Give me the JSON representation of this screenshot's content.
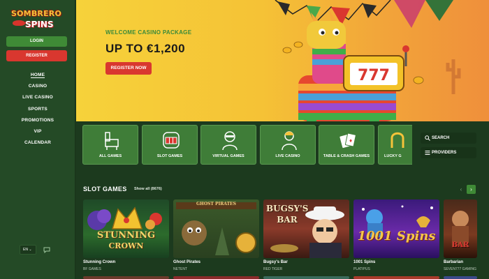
{
  "brand": {
    "line1": "SOMBRERO",
    "line2": "SPINS"
  },
  "auth": {
    "login": "LOGIN",
    "register": "REGISTER"
  },
  "nav": [
    {
      "label": "HOME",
      "active": true
    },
    {
      "label": "CASINO"
    },
    {
      "label": "LIVE CASINO"
    },
    {
      "label": "SPORTS"
    },
    {
      "label": "PROMOTIONS"
    },
    {
      "label": "VIP"
    },
    {
      "label": "CALENDAR"
    }
  ],
  "language": {
    "value": "EN"
  },
  "hero": {
    "kicker": "WELCOME CASINO PACKAGE",
    "headline": "UP TO €1,200",
    "cta": "REGISTER NOW",
    "slot_art": "777"
  },
  "categories": [
    {
      "label": "ALL GAMES",
      "icon": "llama-icon"
    },
    {
      "label": "SLOT GAMES",
      "icon": "slot-machine-icon"
    },
    {
      "label": "VIRTUAL GAMES",
      "icon": "virtual-player-icon"
    },
    {
      "label": "LIVE CASINO",
      "icon": "live-dealer-icon"
    },
    {
      "label": "TABLE & CRASH GAMES",
      "icon": "playing-cards-icon"
    },
    {
      "label": "LUCKY G",
      "icon": "horseshoe-icon"
    }
  ],
  "tools": {
    "search": "SEARCH",
    "providers": "PROVIDERS"
  },
  "slots": {
    "title": "SLOT GAMES",
    "show_all": "Show all (8676)",
    "games": [
      {
        "name": "Stunning Crown",
        "provider": "BF GAMES",
        "art": [
          "STUNNING",
          "CROWN"
        ]
      },
      {
        "name": "Ghost Pirates",
        "provider": "NETENT",
        "art": [
          "GHOST",
          "PIRATES"
        ]
      },
      {
        "name": "Bugsy's Bar",
        "provider": "RED TIGER",
        "art": [
          "BUGSY'S",
          "BAR"
        ]
      },
      {
        "name": "1001 Spins",
        "provider": "PLATIPUS",
        "art": [
          "1001",
          "Spins"
        ]
      },
      {
        "name": "Barbarian",
        "provider": "SEVEN777 GAMING",
        "art": [
          "BAR",
          ""
        ]
      }
    ]
  },
  "colors": {
    "accent_green": "#3f8a36",
    "accent_red": "#d9372f",
    "sidebar": "#244a26",
    "background": "#1c3a1e"
  }
}
